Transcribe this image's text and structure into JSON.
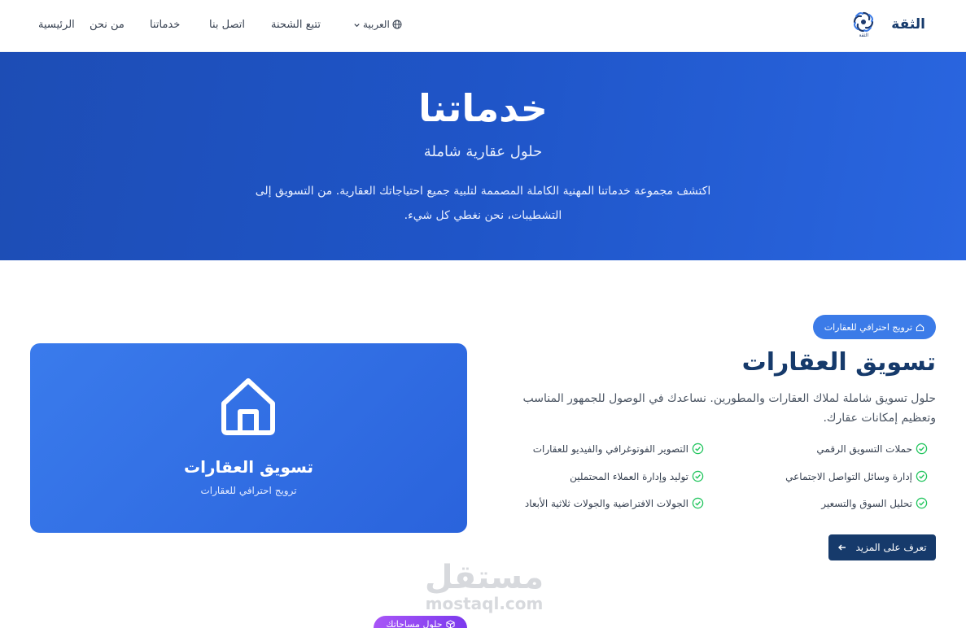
{
  "brand": {
    "name": "الثقة",
    "logo_caption": "الثقة"
  },
  "nav": {
    "home": "الرئيسية",
    "about": "من نحن",
    "services": "خدماتنا",
    "contact": "اتصل بنا",
    "track": "تتبع الشحنة",
    "language": "العربية"
  },
  "hero": {
    "title": "خدماتنا",
    "subtitle": "حلول عقارية شاملة",
    "description": "اكتشف مجموعة خدماتنا المهنية الكاملة المصممة لتلبية جميع احتياجاتك العقارية. من التسويق إلى التشطيبات، نحن نغطي كل شيء."
  },
  "service": {
    "badge": "ترويج احترافي للعقارات",
    "title": "تسويق العقارات",
    "description": "حلول تسويق شاملة لملاك العقارات والمطورين. نساعدك في الوصول للجمهور المناسب وتعظيم إمكانات عقارك.",
    "features": [
      "حملات التسويق الرقمي",
      "التصوير الفوتوغرافي والفيديو للعقارات",
      "إدارة وسائل التواصل الاجتماعي",
      "توليد وإدارة العملاء المحتملين",
      "تحليل السوق والتسعير",
      "الجولات الافتراضية والجولات ثلاثية الأبعاد"
    ],
    "cta": "تعرف على المزيد",
    "card_title": "تسويق العقارات",
    "card_subtitle": "ترويج احترافي للعقارات"
  },
  "next_section": {
    "badge": "حلول مساحاتك"
  },
  "watermark": {
    "arabic": "مستقل",
    "latin": "mostaql.com"
  },
  "colors": {
    "primary": "#163a6b",
    "hero": "#1f55c8",
    "accent": "#3b7be8",
    "check": "#22c55e"
  }
}
